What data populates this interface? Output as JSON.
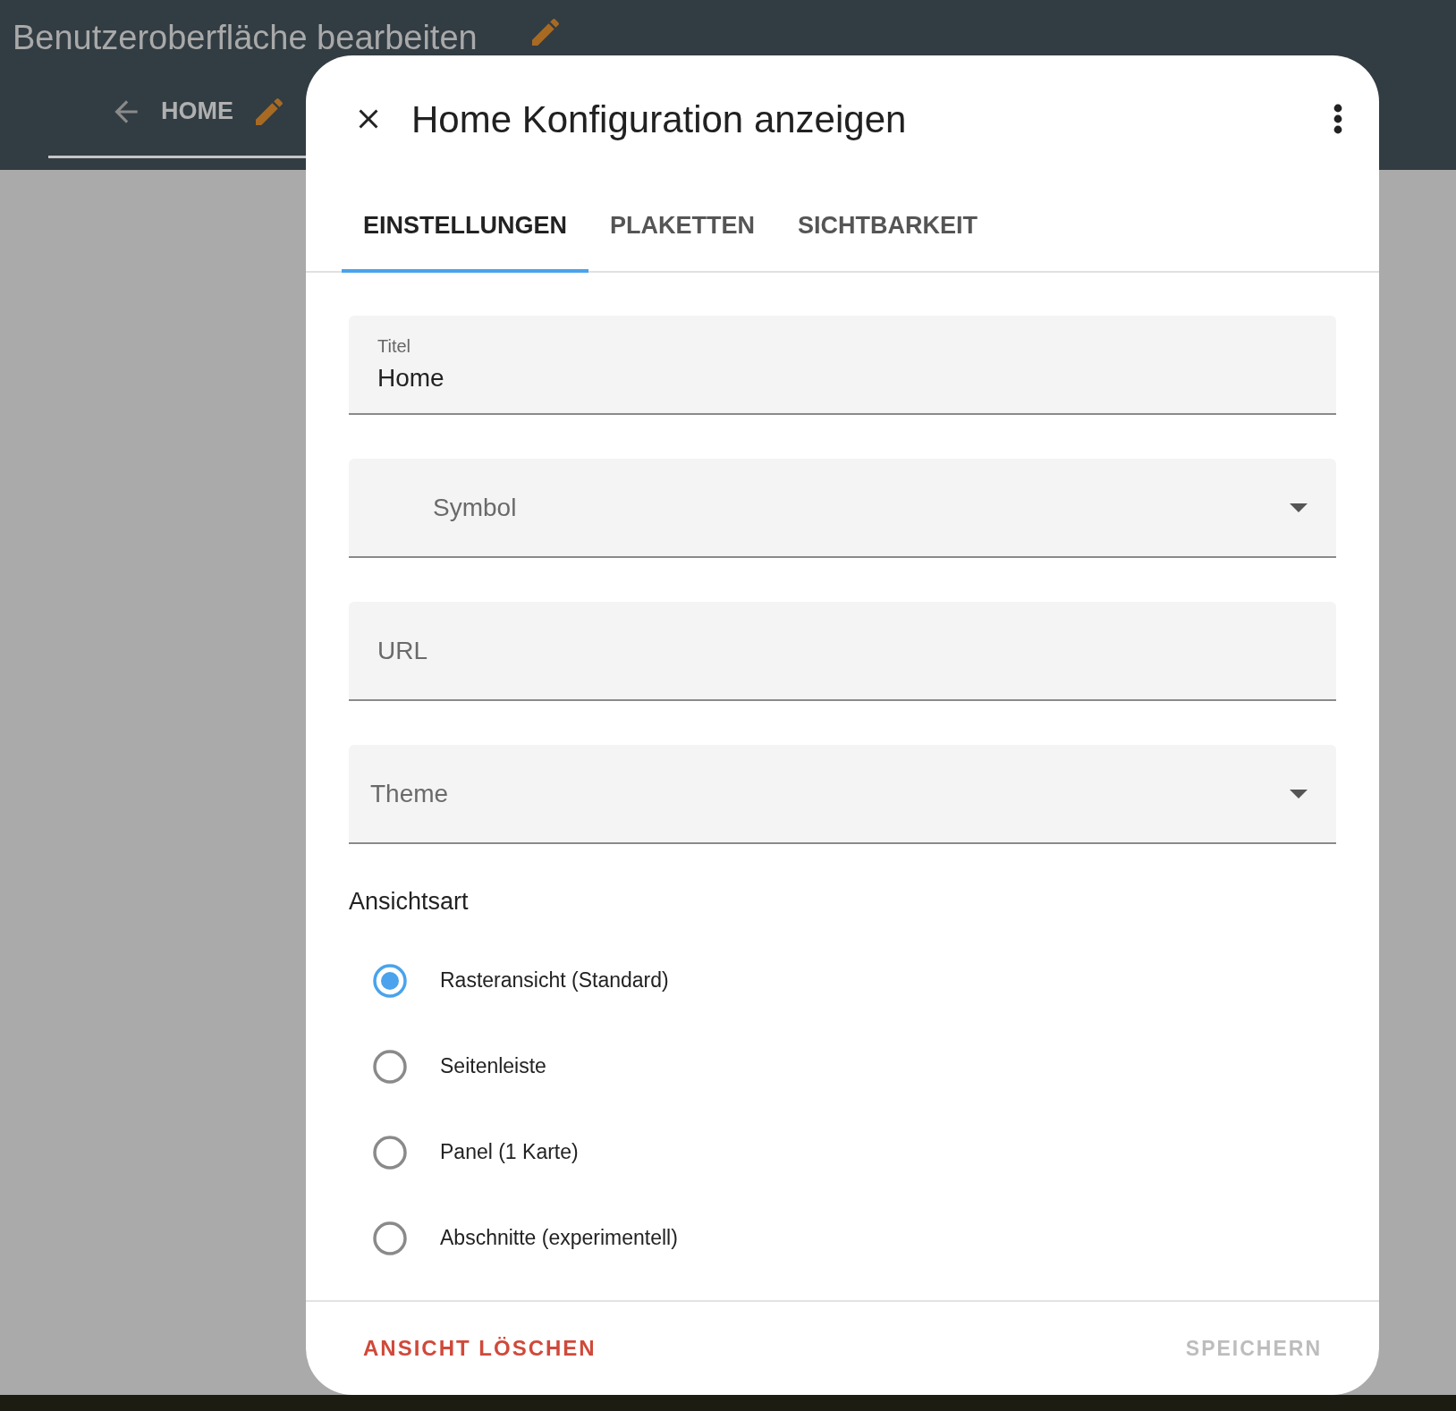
{
  "header": {
    "title": "Benutzeroberfläche bearbeiten",
    "view_tab": "HOME"
  },
  "dialog": {
    "title": "Home Konfiguration anzeigen",
    "tabs": [
      {
        "label": "EINSTELLUNGEN",
        "selected": true
      },
      {
        "label": "PLAKETTEN",
        "selected": false
      },
      {
        "label": "SICHTBARKEIT",
        "selected": false
      }
    ],
    "fields": [
      {
        "kind": "text",
        "label": "Titel",
        "value": "Home"
      },
      {
        "kind": "icon-select",
        "label": "Symbol"
      },
      {
        "kind": "text",
        "label": "URL"
      },
      {
        "kind": "select",
        "label": "Theme"
      }
    ],
    "view_type": {
      "label": "Ansichtsart",
      "options": [
        {
          "label": "Rasteransicht (Standard)",
          "selected": true
        },
        {
          "label": "Seitenleiste",
          "selected": false
        },
        {
          "label": "Panel (1 Karte)",
          "selected": false
        },
        {
          "label": "Abschnitte (experimentell)",
          "selected": false
        }
      ]
    },
    "footer": {
      "delete_button": "ANSICHT LÖSCHEN",
      "save_button": "SPEICHERN"
    }
  }
}
